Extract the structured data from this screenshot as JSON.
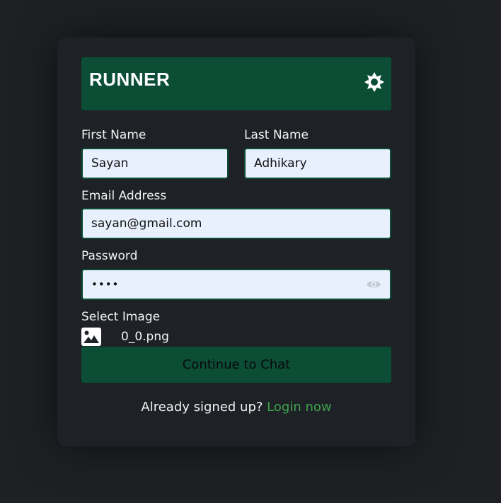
{
  "header": {
    "title": "RUNNER",
    "theme_icon": "sun-icon"
  },
  "form": {
    "first_name": {
      "label": "First Name",
      "value": "Sayan"
    },
    "last_name": {
      "label": "Last Name",
      "value": "Adhikary"
    },
    "email": {
      "label": "Email Address",
      "value": "sayan@gmail.com"
    },
    "password": {
      "label": "Password",
      "value": "••••",
      "toggle_icon": "eye-icon"
    },
    "image": {
      "label": "Select Image",
      "icon": "image-icon",
      "file_name": "0_0.png"
    },
    "submit_label": "Continue to Chat"
  },
  "footer": {
    "prompt": "Already signed up?",
    "link": "Login now"
  },
  "colors": {
    "brand": "#0b4d35",
    "link": "#3fa34d",
    "input_bg": "#e8f0fe"
  }
}
